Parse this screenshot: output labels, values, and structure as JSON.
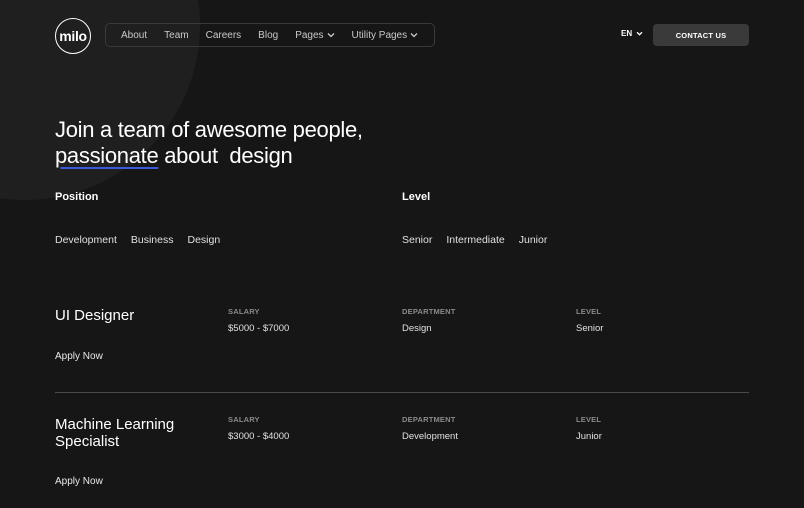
{
  "header": {
    "logo": "milo",
    "nav": [
      {
        "label": "About",
        "dropdown": false
      },
      {
        "label": "Team",
        "dropdown": false
      },
      {
        "label": "Careers",
        "dropdown": false
      },
      {
        "label": "Blog",
        "dropdown": false
      },
      {
        "label": "Pages",
        "dropdown": true
      },
      {
        "label": "Utility Pages",
        "dropdown": true
      }
    ],
    "language": "EN",
    "contact_label": "CONTACT US"
  },
  "hero": {
    "line1": "Join a team of awesome people,",
    "highlight": "passionate",
    "line2_rest": " about  design",
    "accent_color": "#3b5bdb"
  },
  "filters": {
    "position": {
      "heading": "Position",
      "options": [
        "Development",
        "Business",
        "Design"
      ]
    },
    "level": {
      "heading": "Level",
      "options": [
        "Senior",
        "Intermediate",
        "Junior"
      ]
    }
  },
  "jobs": [
    {
      "title": "UI Designer",
      "salary_label": "SALARY",
      "salary": "$5000 - $7000",
      "department_label": "DEPARTMENT",
      "department": "Design",
      "level_label": "LEVEL",
      "level": "Senior",
      "apply_label": "Apply Now"
    },
    {
      "title": "Machine Learning Specialist",
      "salary_label": "SALARY",
      "salary": "$3000 - $4000",
      "department_label": "DEPARTMENT",
      "department": "Development",
      "level_label": "LEVEL",
      "level": "Junior",
      "apply_label": "Apply Now"
    }
  ]
}
